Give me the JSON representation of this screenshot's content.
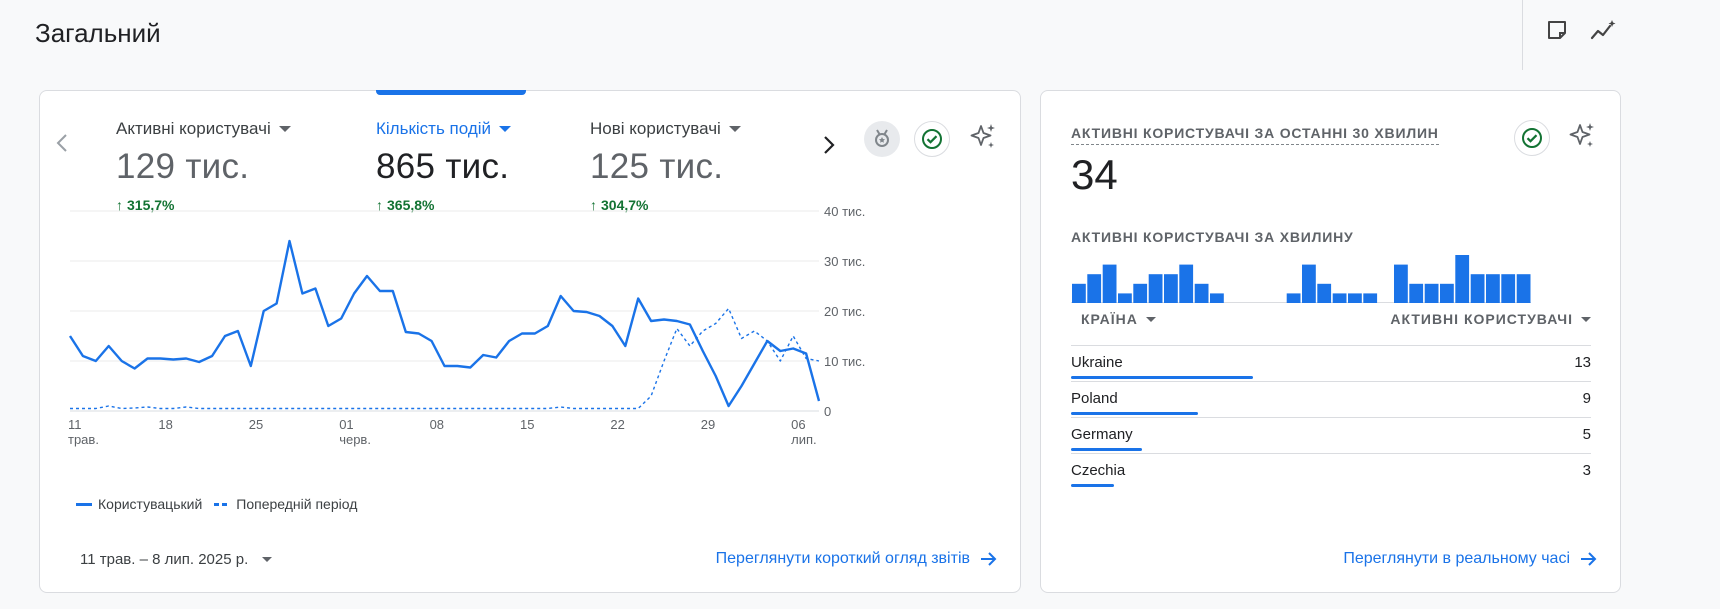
{
  "page": {
    "title": "Загальний"
  },
  "main_card": {
    "metrics": [
      {
        "label": "Активні користувачі",
        "value": "129 тис.",
        "change": "315,7%"
      },
      {
        "label": "Кількість подій",
        "value": "865 тис.",
        "change": "365,8%"
      },
      {
        "label": "Нові користувачі",
        "value": "125 тис.",
        "change": "304,7%"
      }
    ],
    "legend": {
      "current": "Користувацький",
      "previous": "Попередній період"
    },
    "date_range": "11 трав. – 8 лип. 2025 р.",
    "link": "Переглянути короткий огляд звітів"
  },
  "chart_data": {
    "type": "line",
    "x": [
      "11 трав.",
      "12",
      "13",
      "14",
      "15",
      "16",
      "17",
      "18",
      "19",
      "20",
      "21",
      "22",
      "23",
      "24",
      "25",
      "26",
      "27",
      "28",
      "29",
      "30",
      "31",
      "01 черв.",
      "02",
      "03",
      "04",
      "05",
      "06",
      "07",
      "08",
      "09",
      "10",
      "11",
      "12",
      "13",
      "14",
      "15",
      "16",
      "17",
      "18",
      "19",
      "20",
      "21",
      "22",
      "23",
      "24",
      "25",
      "26",
      "27",
      "28",
      "29",
      "30",
      "01",
      "02",
      "03",
      "04",
      "05",
      "06 лип.",
      "07",
      "08"
    ],
    "x_tick_labels": [
      {
        "day": "11",
        "month": "трав."
      },
      {
        "day": "18",
        "month": ""
      },
      {
        "day": "25",
        "month": ""
      },
      {
        "day": "01",
        "month": "черв."
      },
      {
        "day": "08",
        "month": ""
      },
      {
        "day": "15",
        "month": ""
      },
      {
        "day": "22",
        "month": ""
      },
      {
        "day": "29",
        "month": ""
      },
      {
        "day": "06",
        "month": "лип."
      }
    ],
    "y_tick_labels": [
      "0",
      "10 тис.",
      "20 тис.",
      "30 тис.",
      "40 тис."
    ],
    "ylim": [
      0,
      40000
    ],
    "series": [
      {
        "name": "Користувацький",
        "style": "solid",
        "values": [
          15000,
          11000,
          10000,
          13000,
          10000,
          8500,
          10500,
          10500,
          10300,
          10500,
          9800,
          11000,
          15000,
          16000,
          9000,
          20000,
          21500,
          34000,
          23500,
          24500,
          17000,
          18500,
          23500,
          27000,
          24000,
          24000,
          15800,
          15500,
          14000,
          9000,
          9000,
          8700,
          11200,
          10700,
          14000,
          15500,
          15500,
          17000,
          23000,
          20000,
          19800,
          19000,
          17000,
          13000,
          22500,
          18000,
          18300,
          18000,
          17300,
          12000,
          7000,
          1000,
          5000,
          9500,
          14000,
          12000,
          12500,
          11500,
          2000
        ]
      },
      {
        "name": "Попередній період",
        "style": "dashed",
        "values": [
          500,
          500,
          500,
          1000,
          500,
          600,
          800,
          500,
          500,
          800,
          500,
          500,
          500,
          500,
          500,
          500,
          500,
          500,
          500,
          500,
          500,
          500,
          500,
          500,
          500,
          500,
          500,
          500,
          500,
          500,
          500,
          500,
          500,
          500,
          500,
          500,
          500,
          500,
          800,
          500,
          500,
          500,
          500,
          500,
          500,
          3000,
          10000,
          16500,
          13000,
          16000,
          17500,
          20500,
          14500,
          16000,
          14000,
          10000,
          15000,
          10500,
          10000
        ]
      }
    ],
    "legend_position": "bottom-left",
    "colors": {
      "line": "#1a73e8",
      "grid": "#e8eaed"
    }
  },
  "realtime_card": {
    "title": "АКТИВНІ КОРИСТУВАЧІ ЗА ОСТАННІ 30 ХВИЛИН",
    "value": "34",
    "subtitle": "АКТИВНІ КОРИСТУВАЧІ ЗА ХВИЛИНУ",
    "per_minute": [
      2,
      3,
      4,
      1,
      2,
      3,
      3,
      4,
      2,
      1,
      0,
      0,
      0,
      0,
      1,
      4,
      2,
      1,
      1,
      1,
      0,
      4,
      2,
      2,
      2,
      5,
      3,
      3,
      3,
      3
    ],
    "per_minute_max": 5,
    "table_headers": {
      "country": "КРАЇНА",
      "users": "АКТИВНІ КОРИСТУВАЧІ"
    },
    "rows": [
      {
        "country": "Ukraine",
        "value": "13",
        "share": 0.35
      },
      {
        "country": "Poland",
        "value": "9",
        "share": 0.245
      },
      {
        "country": "Germany",
        "value": "5",
        "share": 0.137
      },
      {
        "country": "Czechia",
        "value": "3",
        "share": 0.082
      }
    ],
    "link": "Переглянути в реальному часі"
  }
}
